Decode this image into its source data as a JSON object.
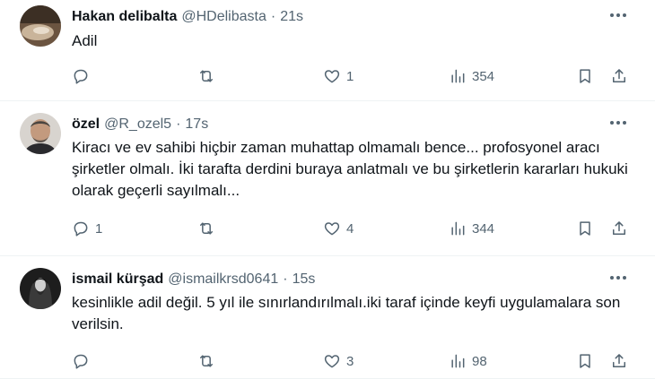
{
  "tweets": [
    {
      "name": "Hakan delibalta",
      "handle": "@HDelibasta",
      "sep": "·",
      "time": "21s",
      "text": "Adil",
      "stats": {
        "reply": "",
        "retweet": "",
        "like": "1",
        "views": "354"
      }
    },
    {
      "name": "özel",
      "handle": "@R_ozel5",
      "sep": "·",
      "time": "17s",
      "text": "Kiracı ve ev sahibi hiçbir zaman muhattap olmamalı bence... profosyonel aracı şirketler olmalı. İki tarafta derdini buraya anlatmalı ve bu şirketlerin kararları hukuki olarak geçerli sayılmalı...",
      "stats": {
        "reply": "1",
        "retweet": "",
        "like": "4",
        "views": "344"
      }
    },
    {
      "name": "ismail kürşad",
      "handle": "@ismailkrsd0641",
      "sep": "·",
      "time": "15s",
      "text": "kesinlikle adil değil. 5 yıl ile sınırlandırılmalı.iki taraf içinde keyfi uygulamalara son verilsin.",
      "stats": {
        "reply": "",
        "retweet": "",
        "like": "3",
        "views": "98"
      }
    }
  ],
  "icons": {
    "reply": "reply-icon",
    "retweet": "retweet-icon",
    "like": "like-icon",
    "views": "views-icon",
    "bookmark": "bookmark-icon",
    "share": "share-icon",
    "more": "more-icon"
  },
  "colors": {
    "text": "#0f1419",
    "secondary": "#536471",
    "divider": "#eff3f4"
  }
}
